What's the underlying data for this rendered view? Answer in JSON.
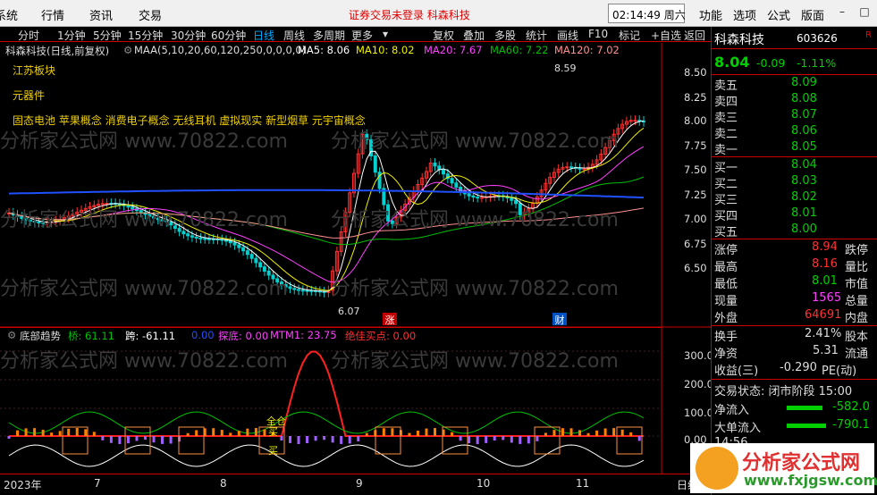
{
  "menubar": {
    "items": [
      "系统",
      "行情",
      "资讯",
      "交易"
    ],
    "notice": "证券交易未登录  科森科技",
    "clock": "02:14:49 周六",
    "right_items": [
      "功能",
      "选项",
      "公式",
      "版面"
    ],
    "win": [
      "–",
      "□",
      "✕"
    ]
  },
  "toolbar": {
    "periods": [
      "分时",
      "1分钟",
      "5分钟",
      "15分钟",
      "30分钟",
      "60分钟",
      "日线",
      "周线",
      "多周期",
      "更多"
    ],
    "actions": [
      "复权",
      "叠加",
      "多股",
      "统计",
      "画线",
      "F10",
      "标记",
      "+自选",
      "返回"
    ]
  },
  "chart": {
    "stock_label": "科森科技(日线,前复权)",
    "maa_label": "MAA(5,10,20,60,120,250,0,0,0,0)",
    "ma5": "MA5: 8.06",
    "ma10": "MA10: 8.02",
    "ma20": "MA20: 7.67",
    "ma60": "MA60: 7.22",
    "ma120": "MA120: 7.02",
    "concepts": [
      "江苏板块",
      "元器件",
      "固态电池 苹果概念 消费电子概念 无线耳机 虚拟现实 新型烟草 元宇宙概念"
    ],
    "high_label": "8.59",
    "low_label": "6.07",
    "marker_rise": "涨",
    "marker_fin": "财",
    "y_ticks": [
      "8.50",
      "8.25",
      "8.00",
      "7.75",
      "7.50",
      "7.25",
      "7.00",
      "6.75",
      "6.50"
    ],
    "ind_y_ticks": [
      "300.0",
      "200.0",
      "100.0",
      "0.00"
    ],
    "indicator": {
      "name": "底部趋势",
      "qiao": "桥: 61.11",
      "kua": "跨: -61.11",
      "b": "0.00",
      "tandi": "探底: 0.00",
      "mtm": "MTM1: 23.75",
      "jjmd": "绝佳买点: 0.00",
      "ann1": "全仓",
      "ann2": "买",
      "ann3": "买"
    },
    "x_labels": [
      "2023年",
      "7",
      "8",
      "9",
      "10",
      "11"
    ],
    "bottom_right": "日线"
  },
  "quote": {
    "name": "科森科技",
    "code": "603626",
    "r": "R",
    "price": "8.04",
    "change": "-0.09",
    "pct": "-1.11%",
    "sells": [
      [
        "卖五",
        "8.09"
      ],
      [
        "卖四",
        "8.08"
      ],
      [
        "卖三",
        "8.07"
      ],
      [
        "卖二",
        "8.06"
      ],
      [
        "卖一",
        "8.05"
      ]
    ],
    "buys": [
      [
        "买一",
        "8.04"
      ],
      [
        "买二",
        "8.03"
      ],
      [
        "买三",
        "8.02"
      ],
      [
        "买四",
        "8.01"
      ],
      [
        "买五",
        "8.00"
      ]
    ],
    "stats": [
      [
        "涨停",
        "8.94",
        "跌停",
        ""
      ],
      [
        "最高",
        "8.16",
        "量比",
        ""
      ],
      [
        "最低",
        "8.01",
        "市值",
        ""
      ],
      [
        "现量",
        "1565",
        "总量",
        ""
      ],
      [
        "外盘",
        "64691",
        "内盘",
        ""
      ]
    ],
    "stats2": [
      [
        "换手",
        "2.41%",
        "股本"
      ],
      [
        "净资",
        "5.31",
        "流通"
      ],
      [
        "收益(三)",
        "-0.290",
        "PE(动)"
      ]
    ],
    "trade_status": "交易状态: 闭市阶段 15:00",
    "flow": [
      [
        "净流入",
        "-582.0"
      ],
      [
        "大单流入",
        "-790.1"
      ]
    ],
    "last": "14:56"
  },
  "colors": {
    "up": "#ff3030",
    "down": "#00d0d0",
    "ma5": "#ffffff",
    "ma10": "#f0f000",
    "ma20": "#ff40ff",
    "ma60": "#00c000",
    "ma120": "#ff9090",
    "ma250": "#2050ff"
  },
  "watermark": "分析家公式网 www.70822.com",
  "logo": {
    "title": "分析家公式网",
    "url": "www.fxjgsw.com"
  }
}
